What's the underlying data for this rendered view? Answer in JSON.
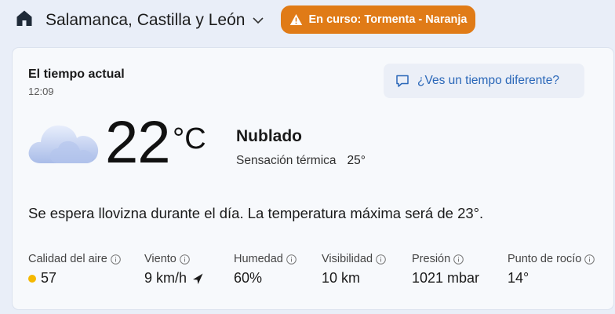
{
  "header": {
    "location": "Salamanca, Castilla y León",
    "alert": "En curso: Tormenta - Naranja"
  },
  "current": {
    "title": "El tiempo actual",
    "time": "12:09",
    "temperature": "22",
    "unit": "°C",
    "condition": "Nublado",
    "feels_label": "Sensación térmica",
    "feels_value": "25°",
    "different_weather": "¿Ves un tiempo diferente?",
    "summary": "Se espera llovizna durante el día. La temperatura máxima será de 23°."
  },
  "metrics": [
    {
      "label": "Calidad del aire",
      "value": "57"
    },
    {
      "label": "Viento",
      "value": "9 km/h"
    },
    {
      "label": "Humedad",
      "value": "60%"
    },
    {
      "label": "Visibilidad",
      "value": "10 km"
    },
    {
      "label": "Presión",
      "value": "1021 mbar"
    },
    {
      "label": "Punto de rocío",
      "value": "14°"
    }
  ],
  "colors": {
    "alert": "#e07b17",
    "link": "#2a67b8",
    "aqi_dot": "#f5b800"
  },
  "icons": [
    "home-icon",
    "chevron-down-icon",
    "warning-icon",
    "feedback-icon",
    "cloud-icon",
    "info-icon",
    "wind-direction-icon"
  ]
}
